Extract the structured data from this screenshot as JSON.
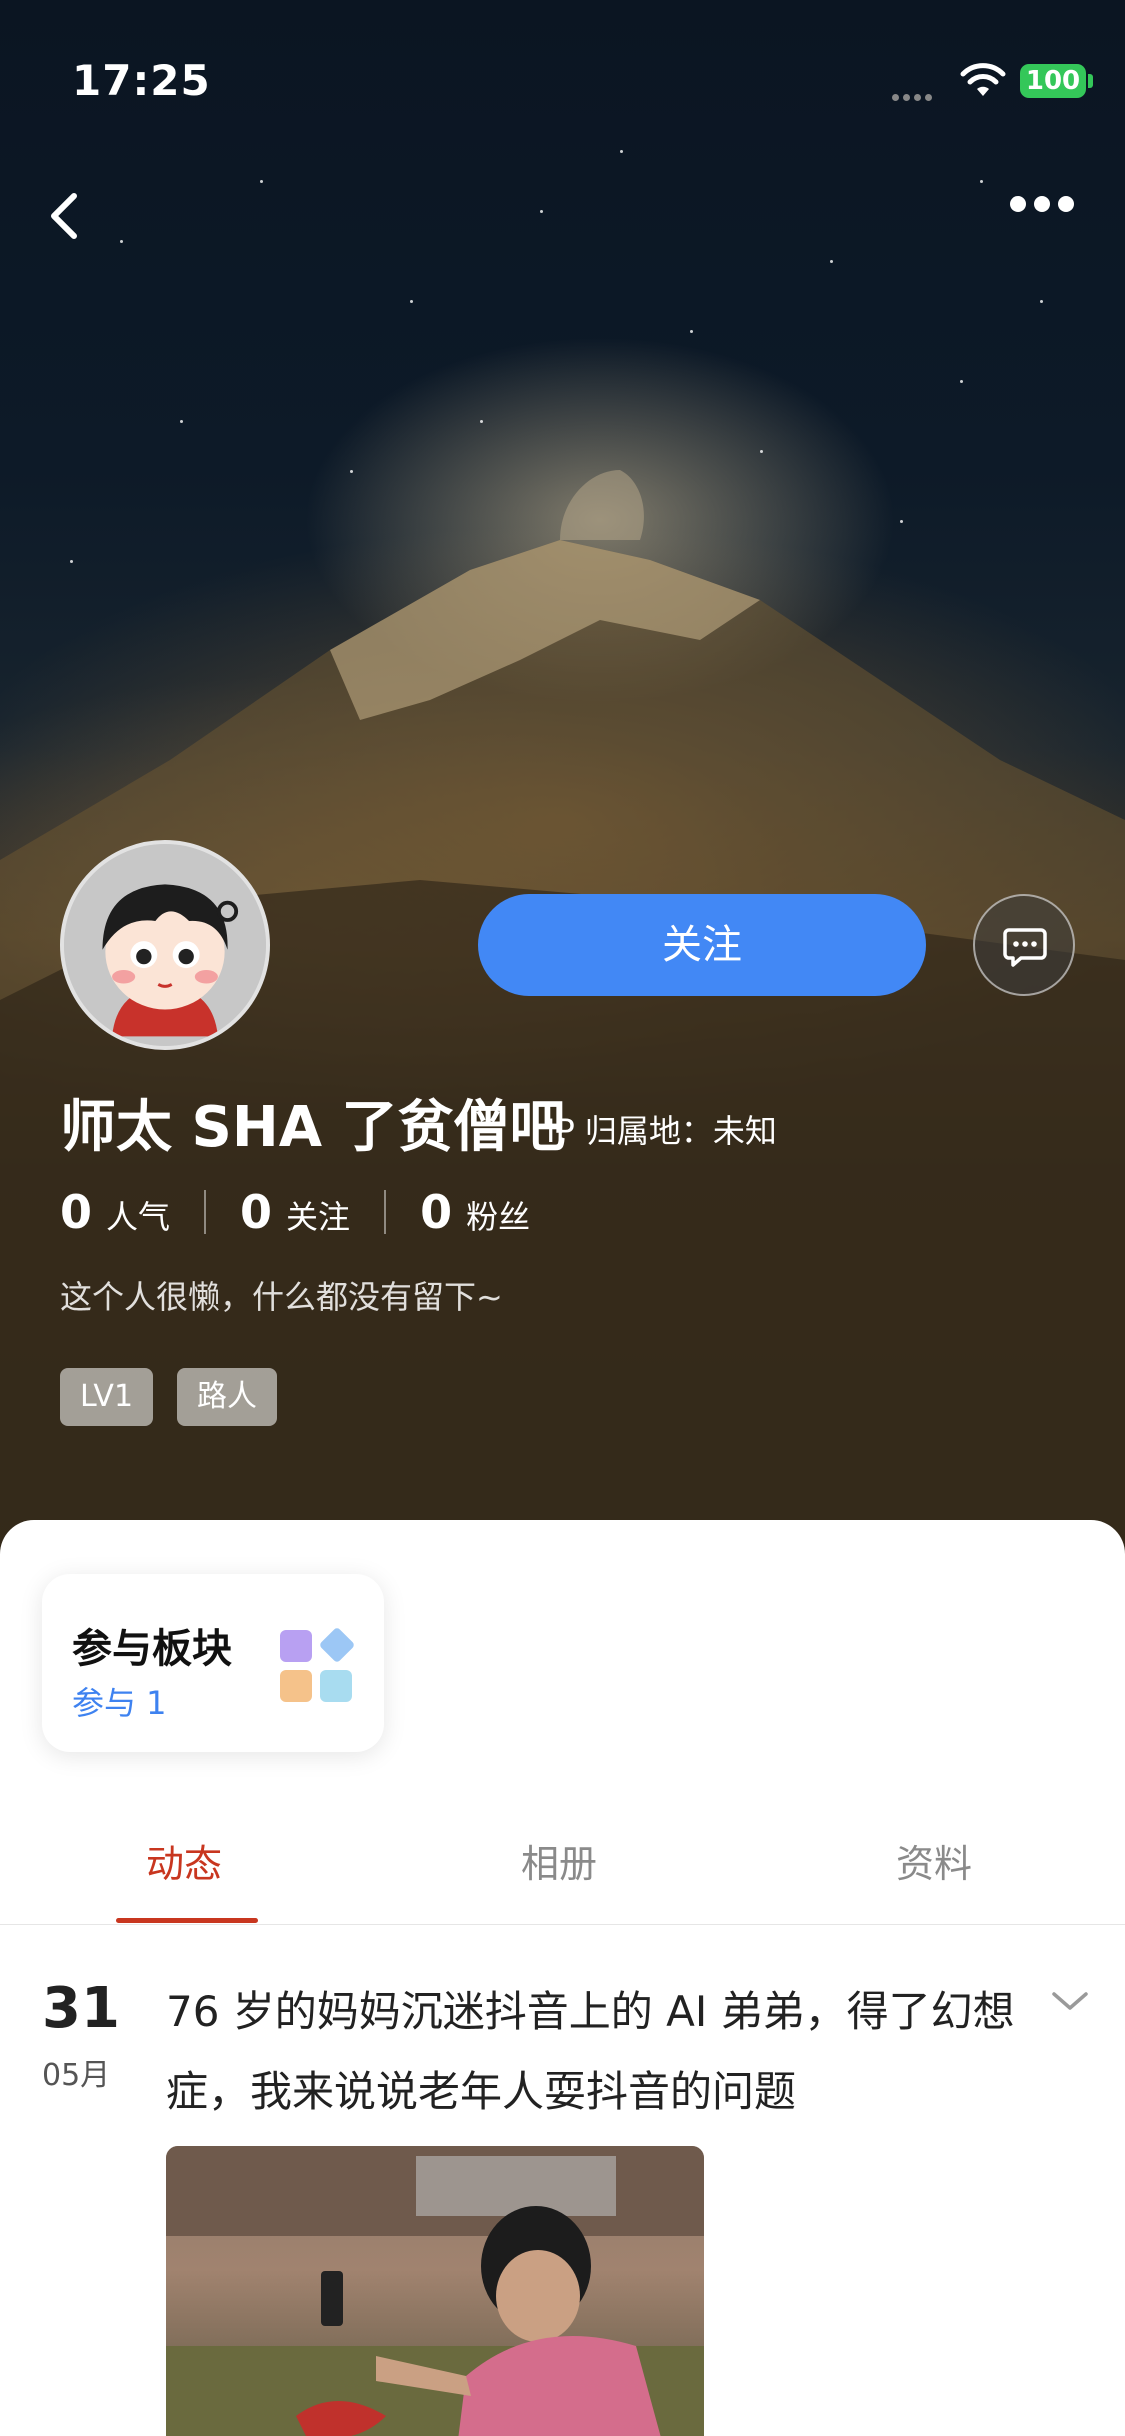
{
  "status_bar": {
    "time": "17:25",
    "battery": "100"
  },
  "profile": {
    "follow_label": "关注",
    "username": "师太 SHA 了贫僧吧",
    "ip_location": "IP 归属地：未知",
    "stats": [
      {
        "value": "0",
        "label": "人气"
      },
      {
        "value": "0",
        "label": "关注"
      },
      {
        "value": "0",
        "label": "粉丝"
      }
    ],
    "bio": "这个人很懒，什么都没有留下~",
    "tags": [
      "LV1",
      "路人"
    ]
  },
  "board_card": {
    "title": "参与板块",
    "count": "参与 1"
  },
  "tabs": [
    "动态",
    "相册",
    "资料"
  ],
  "post": {
    "day": "31",
    "month": "05月",
    "title": "76 岁的妈妈沉迷抖音上的 AI 弟弟，得了幻想症，我来说说老年人耍抖音的问题"
  },
  "icons": [
    "back-arrow-icon",
    "more-dots-icon",
    "chat-bubble-icon",
    "wifi-icon",
    "chevron-down-icon",
    "board-grid-icon"
  ],
  "colors": {
    "follow_button": "#4288f5",
    "active_tab": "#c8361f",
    "board_count": "#3e82f0"
  }
}
